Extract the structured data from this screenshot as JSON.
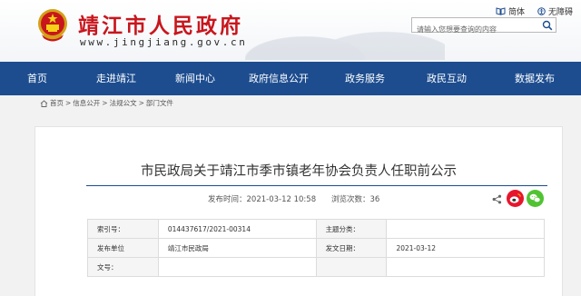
{
  "header": {
    "title": "靖江市人民政府",
    "url": "www.jingjiang.gov.cn",
    "links": [
      {
        "label": "简体",
        "icon": "book-icon"
      },
      {
        "label": "无障碍",
        "icon": "accessibility-icon"
      }
    ],
    "search": {
      "placeholder": "请输入您想要查询的内容",
      "icon": "search-icon"
    }
  },
  "nav": {
    "items": [
      "首页",
      "走进靖江",
      "新闻中心",
      "政府信息公开",
      "政务服务",
      "政民互动",
      "数据发布"
    ]
  },
  "breadcrumb": {
    "items": [
      "首页",
      "信息公开",
      "法规公文",
      "部门文件"
    ],
    "separator": ">"
  },
  "article": {
    "title": "市民政局关于靖江市季市镇老年协会负责人任职前公示",
    "publish_label": "发布时间：",
    "publish_time": "2021-03-12 10:58",
    "views_label": "浏览次数：",
    "views": "36",
    "share_icons": [
      "share-icon",
      "weibo-icon",
      "wechat-icon"
    ]
  },
  "info_table": {
    "rows": [
      {
        "label1": "索引号：",
        "value1": "014437617/2021-00314",
        "label2": "主题分类：",
        "value2": ""
      },
      {
        "label1": "发布单位",
        "value1": "靖江市民政局",
        "label2": "发文日期：",
        "value2": "2021-03-12"
      },
      {
        "label1": "文号：",
        "value1": "",
        "label2": "",
        "value2": ""
      }
    ]
  },
  "colors": {
    "brand_red": "#c8161d",
    "nav_blue": "#1d4d8f",
    "weibo": "#e6162d",
    "wechat": "#51c332"
  }
}
